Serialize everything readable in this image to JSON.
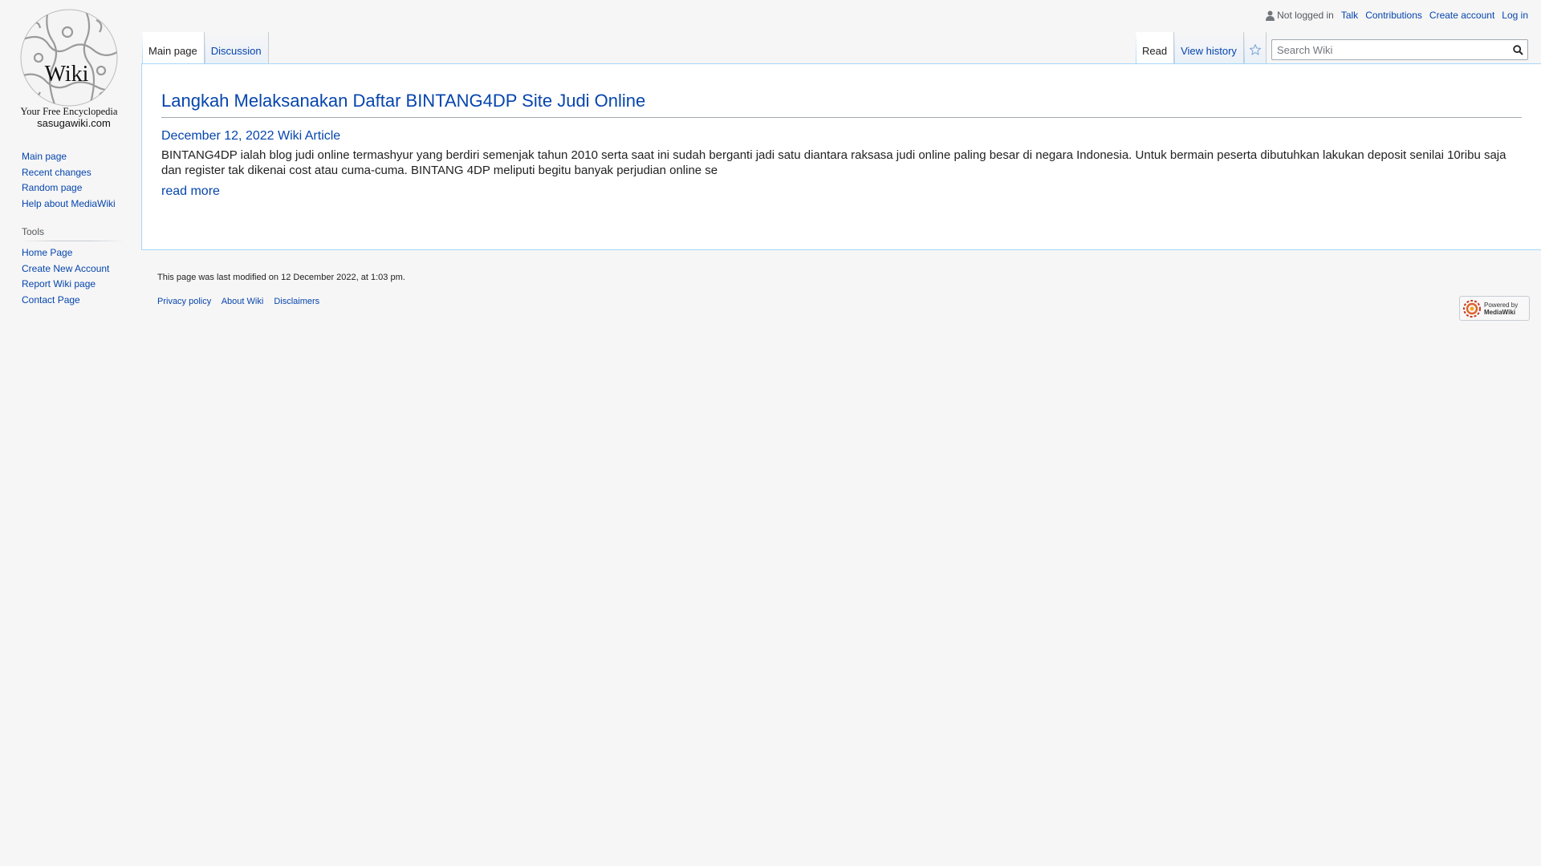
{
  "logo": {
    "title": "Wiki",
    "tagline": "Your Free Encyclopedia",
    "domain": "sasugawiki.com"
  },
  "personal_tools": {
    "status": "Not logged in",
    "links": [
      "Talk",
      "Contributions",
      "Create account",
      "Log in"
    ]
  },
  "tabs": {
    "namespaces": [
      "Main page",
      "Discussion"
    ],
    "views": [
      "Read",
      "View history"
    ]
  },
  "search": {
    "placeholder": "Search Wiki"
  },
  "sidebar": {
    "navigation": [
      "Main page",
      "Recent changes",
      "Random page",
      "Help about MediaWiki"
    ],
    "tools_title": "Tools",
    "tools": [
      "Home Page",
      "Create New Account",
      "Report Wiki page",
      "Contact Page"
    ]
  },
  "article": {
    "title": "Langkah Melaksanakan Daftar BINTANG4DP Site Judi Online",
    "meta": "December 12, 2022 Wiki Article",
    "excerpt": "BINTANG4DP ialah blog judi online termashyur yang berdiri semenjak tahun 2010 serta saat ini sudah berganti jadi satu diantara raksasa judi online paling besar di negara Indonesia. Untuk bermain peserta dibutuhkan lakukan deposit senilai 10ribu saja dan register tak dikenai cost atau cuma-cuma. BINTANG 4DP meliputi begitu banyak perjudian online se",
    "read_more": "read more"
  },
  "footer": {
    "last_modified": "This page was last modified on 12 December 2022, at 1:03 pm.",
    "links": [
      "Privacy policy",
      "About Wiki",
      "Disclaimers"
    ],
    "powered_by": [
      "Powered by",
      "MediaWiki"
    ]
  }
}
